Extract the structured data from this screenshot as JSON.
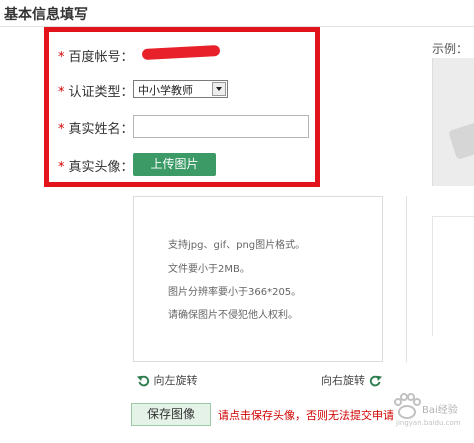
{
  "header": {
    "title": "基本信息填写"
  },
  "example": {
    "label": "示例："
  },
  "form": {
    "required_mark": "*",
    "account": {
      "label": "百度帐号：",
      "value": ""
    },
    "cert_type": {
      "label": "认证类型：",
      "selected": "中小学教师"
    },
    "real_name": {
      "label": "真实姓名：",
      "value": ""
    },
    "avatar": {
      "label": "真实头像：",
      "upload_label": "上传图片"
    }
  },
  "preview": {
    "info_lines": [
      "支持jpg、gif、png图片格式。",
      "文件要小于2MB。",
      "图片分辨率要小于366*205。",
      "请确保图片不侵犯他人权利。"
    ],
    "rotate_left_label": "向左旋转",
    "rotate_right_label": "向右旋转"
  },
  "footer": {
    "save_label": "保存图像",
    "note": "请点击保存头像，否则无法提交申请"
  },
  "watermark": {
    "brand": "Bai经验",
    "sub": "jingyan.baidu.com"
  },
  "colors": {
    "highlight": "#e2131b",
    "upload_button": "#3c9a67",
    "required_star": "#d20000",
    "note_text": "#d00000"
  }
}
